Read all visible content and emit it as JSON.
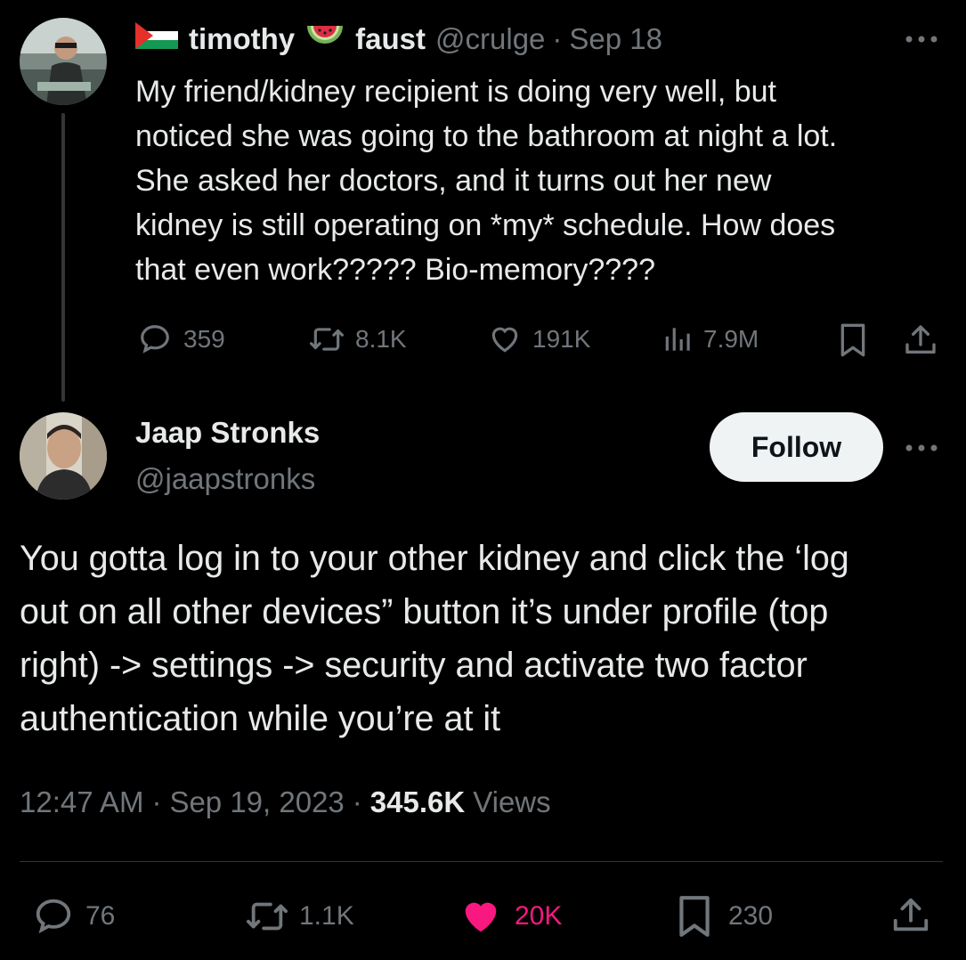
{
  "parent_tweet": {
    "display_name_first": "timothy",
    "display_name_second": "faust",
    "handle": "@crulge",
    "separator": "·",
    "date": "Sep 18",
    "text_lines": [
      "My friend/kidney recipient is doing very well, but",
      "noticed she was going to the bathroom at night a lot.",
      "She asked her doctors, and it turns out her new",
      "kidney is still operating on *my* schedule. How does",
      "that even work????? Bio-memory????"
    ],
    "stats": {
      "replies": "359",
      "reposts": "8.1K",
      "likes": "191K",
      "views": "7.9M"
    },
    "icons": [
      "palestine-flag-icon",
      "watermelon-icon",
      "more-icon",
      "reply-icon",
      "repost-icon",
      "like-icon",
      "views-icon",
      "bookmark-icon",
      "share-icon"
    ]
  },
  "main_tweet": {
    "display_name": "Jaap Stronks",
    "handle": "@jaapstronks",
    "follow_label": "Follow",
    "text_lines": [
      "You gotta log in to your other kidney and click the ‘log",
      "out on all other devices” button it’s under profile (top",
      "right) -> settings -> security and activate two factor",
      "authentication while you’re at it"
    ],
    "time": "12:47 AM",
    "separator": "·",
    "date": "Sep 19, 2023",
    "views_count": "345.6K",
    "views_label": "Views",
    "stats": {
      "replies": "76",
      "reposts": "1.1K",
      "likes": "20K",
      "bookmarks": "230"
    },
    "colors": {
      "like_active": "#f91880",
      "text": "#e7e9ea",
      "muted": "#71767b"
    }
  }
}
